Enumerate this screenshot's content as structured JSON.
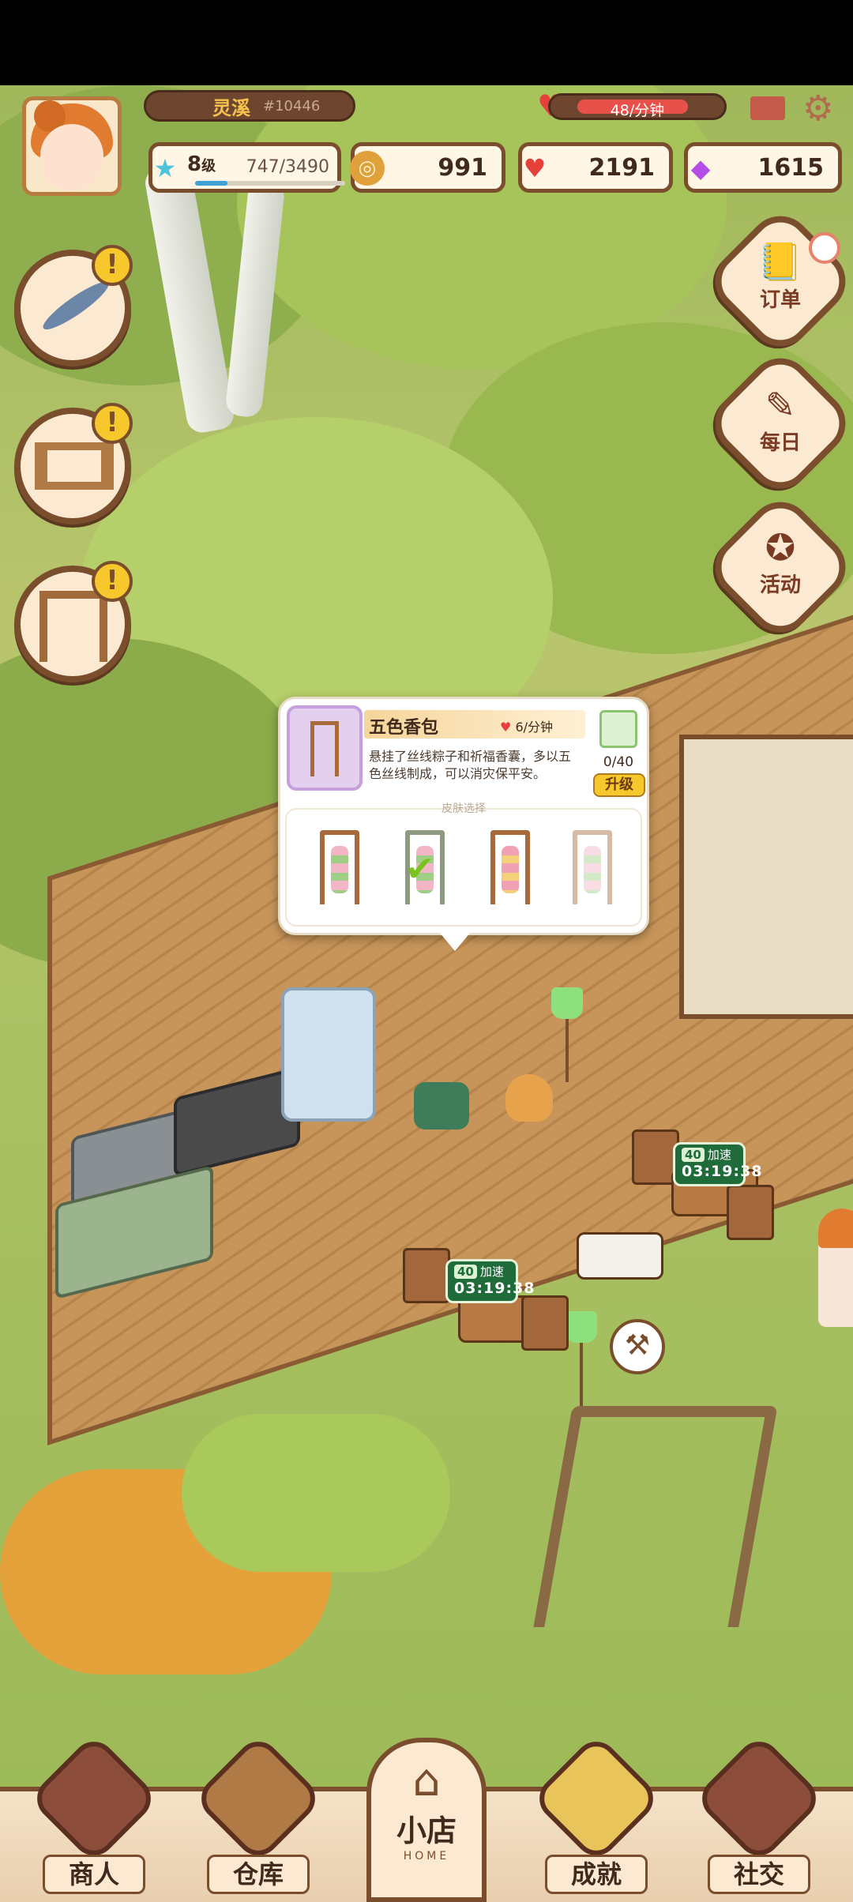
{
  "player": {
    "name": "灵溪",
    "id": "#10446",
    "level_num": "8",
    "level_unit": "级",
    "xp": "747/3490",
    "xp_fraction": 0.214
  },
  "energy": {
    "rate": "48/分钟",
    "fill_fraction": 0.78
  },
  "currencies": {
    "coins": "991",
    "hearts": "2191",
    "gems": "1615"
  },
  "right_menu": [
    {
      "label": "订单",
      "icon": "order-book-icon"
    },
    {
      "label": "每日",
      "icon": "daily-notebook-icon"
    },
    {
      "label": "活动",
      "icon": "event-lantern-icon"
    }
  ],
  "left_menu": [
    {
      "icon": "fish-icon",
      "alert": "!"
    },
    {
      "icon": "fence-icon",
      "alert": "!"
    },
    {
      "icon": "swing-icon",
      "alert": "!"
    }
  ],
  "popup": {
    "name": "五色香包",
    "rate_value": "6",
    "rate_unit": "/分钟",
    "description": "悬挂了丝线粽子和祈福香囊，多以五色丝线制成，可以消灾保平安。",
    "count": "0/40",
    "upgrade_label": "升级",
    "skin_title": "皮肤选择"
  },
  "timers": [
    {
      "badge": "40",
      "label": "加速",
      "time": "03:19:38"
    },
    {
      "badge": "40",
      "label": "加速",
      "time": "03:19:38"
    }
  ],
  "bottom_nav": {
    "merchant": "商人",
    "warehouse": "仓库",
    "shop": "小店",
    "shop_en": "HOME",
    "achievement": "成就",
    "social": "社交"
  },
  "colors": {
    "brand_brown": "#7a4e2d",
    "heart_red": "#e6403b",
    "gold": "#f6c82c",
    "timer_green": "#1f6b3a"
  }
}
